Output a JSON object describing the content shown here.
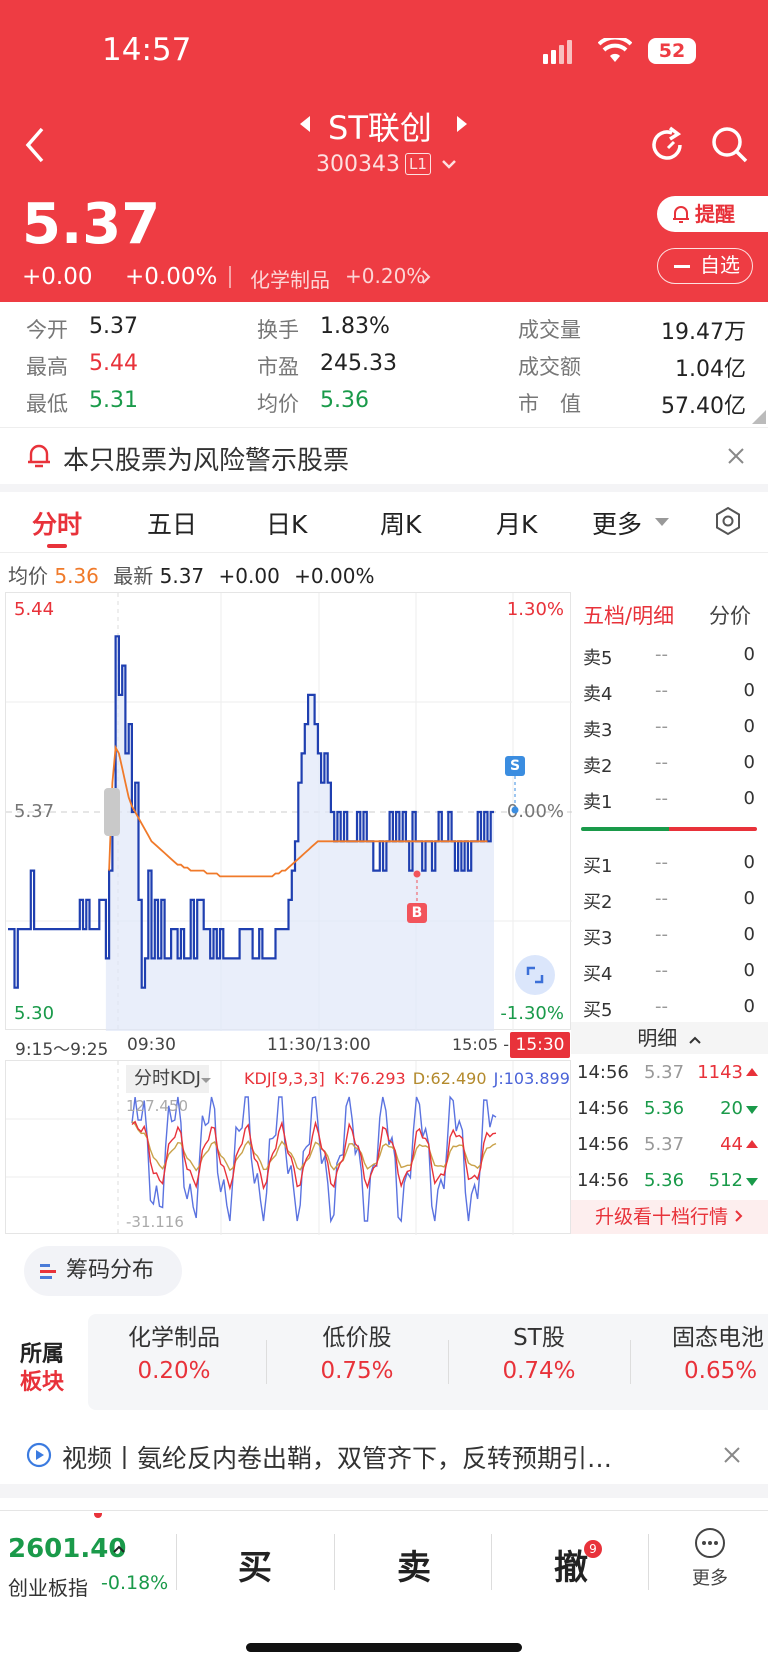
{
  "status_bar": {
    "time": "14:57",
    "battery": "52"
  },
  "header": {
    "title": "ST联创",
    "code": "300343",
    "level_badge": "L1",
    "price": "5.37",
    "change": "+0.00",
    "change_pct": "+0.00%",
    "sector_name": "化学制品",
    "sector_change": "+0.20%",
    "remind_label": "提醒",
    "watchlist_label": "自选"
  },
  "stats": [
    {
      "label": "今开",
      "value": "5.37",
      "tone": "neutral"
    },
    {
      "label": "换手",
      "value": "1.83%",
      "tone": "neutral"
    },
    {
      "label": "成交量",
      "value": "19.47万",
      "tone": "neutral"
    },
    {
      "label": "最高",
      "value": "5.44",
      "tone": "red"
    },
    {
      "label": "市盈",
      "value": "245.33",
      "tone": "neutral"
    },
    {
      "label": "成交额",
      "value": "1.04亿",
      "tone": "neutral"
    },
    {
      "label": "最低",
      "value": "5.31",
      "tone": "green"
    },
    {
      "label": "均价",
      "value": "5.36",
      "tone": "green"
    },
    {
      "label": "市　值",
      "value": "57.40亿",
      "tone": "neutral"
    }
  ],
  "warning": {
    "text": "本只股票为风险警示股票"
  },
  "tabs": {
    "active": "分时",
    "items": [
      "分时",
      "五日",
      "日K",
      "周K",
      "月K",
      "更多"
    ]
  },
  "info_line": {
    "avg_label": "均价",
    "avg_value": "5.36",
    "latest_label": "最新",
    "latest_value": "5.37",
    "change": "+0.00",
    "change_pct": "+0.00%"
  },
  "chart_data": {
    "type": "line",
    "y_labels": {
      "top": "5.44",
      "mid": "5.37",
      "bottom": "5.30",
      "top_pct": "1.30%",
      "mid_pct": "0.00%",
      "bottom_pct": "-1.30%"
    },
    "ylim": [
      5.3,
      5.44
    ],
    "x_labels": [
      "9:15～9:25",
      "09:30",
      "11:30/13:00",
      "15:05 -",
      "15:30"
    ],
    "series": [
      {
        "color": "#1f3fb0",
        "values": [
          5.33,
          5.33,
          5.31,
          5.33,
          5.33,
          5.33,
          5.33,
          5.35,
          5.33,
          5.33,
          5.33,
          5.33,
          5.33,
          5.33,
          5.33,
          5.33,
          5.33,
          5.33,
          5.33,
          5.33,
          5.33,
          5.33,
          5.34,
          5.33,
          5.34,
          5.33,
          5.33,
          5.33,
          5.34,
          5.34,
          5.32,
          5.35,
          5.37,
          5.43,
          5.41,
          5.42,
          5.39,
          5.4,
          5.37,
          5.38,
          5.34,
          5.31,
          5.32,
          5.35,
          5.32,
          5.34,
          5.32,
          5.34,
          5.32,
          5.32,
          5.33,
          5.33,
          5.32,
          5.33,
          5.32,
          5.32,
          5.34,
          5.32,
          5.34,
          5.34,
          5.33,
          5.33,
          5.32,
          5.33,
          5.32,
          5.33,
          5.32,
          5.32,
          5.32,
          5.32,
          5.32,
          5.33,
          5.33,
          5.33,
          5.33,
          5.32,
          5.32,
          5.33,
          5.32,
          5.32,
          5.32,
          5.32,
          5.33,
          5.33,
          5.33,
          5.33,
          5.34,
          5.35,
          5.36,
          5.38,
          5.39,
          5.4,
          5.41,
          5.41,
          5.4,
          5.39,
          5.38,
          5.39,
          5.38,
          5.37,
          5.36,
          5.37,
          5.36,
          5.37,
          5.36,
          5.36,
          5.36,
          5.37,
          5.36,
          5.37,
          5.36,
          5.36,
          5.35,
          5.35,
          5.36,
          5.35,
          5.36,
          5.37,
          5.36,
          5.37,
          5.36,
          5.37,
          5.36,
          5.35,
          5.37,
          5.36,
          5.36,
          5.35,
          5.36,
          5.36,
          5.35,
          5.36,
          5.37,
          5.36,
          5.36,
          5.37,
          5.36,
          5.35,
          5.36,
          5.35,
          5.36,
          5.35,
          5.36,
          5.36,
          5.37,
          5.36,
          5.37,
          5.36,
          5.37,
          5.37
        ]
      },
      {
        "color": "#f07a2a",
        "values": [
          null,
          null,
          null,
          null,
          null,
          null,
          null,
          null,
          null,
          null,
          null,
          null,
          null,
          null,
          null,
          null,
          null,
          null,
          null,
          null,
          null,
          null,
          null,
          null,
          null,
          null,
          null,
          null,
          null,
          null,
          null,
          5.35,
          5.38,
          5.392,
          5.39,
          5.385,
          5.38,
          5.375,
          5.372,
          5.37,
          5.368,
          5.366,
          5.364,
          5.362,
          5.36,
          5.359,
          5.358,
          5.357,
          5.356,
          5.355,
          5.354,
          5.353,
          5.352,
          5.352,
          5.351,
          5.351,
          5.35,
          5.35,
          5.35,
          5.35,
          5.35,
          5.349,
          5.349,
          5.349,
          5.349,
          5.348,
          5.348,
          5.348,
          5.348,
          5.348,
          5.348,
          5.348,
          5.348,
          5.348,
          5.348,
          5.348,
          5.348,
          5.348,
          5.348,
          5.348,
          5.348,
          5.348,
          5.349,
          5.349,
          5.35,
          5.35,
          5.351,
          5.352,
          5.353,
          5.354,
          5.355,
          5.356,
          5.357,
          5.358,
          5.359,
          5.36,
          5.36,
          5.36,
          5.36,
          5.36,
          5.36,
          5.36,
          5.36,
          5.36,
          5.36,
          5.36,
          5.36,
          5.36,
          5.36,
          5.36,
          5.36,
          5.36,
          5.36,
          5.36,
          5.36,
          5.36,
          5.36,
          5.36,
          5.36,
          5.36,
          5.36,
          5.36,
          5.36,
          5.36,
          5.36,
          5.36,
          5.36,
          5.36,
          5.36,
          5.36,
          5.36,
          5.36,
          5.36,
          5.36,
          5.36,
          5.36,
          5.36,
          5.36,
          5.36,
          5.36,
          5.36,
          5.36,
          5.36,
          5.36,
          5.36,
          5.36,
          5.36,
          5.36
        ]
      }
    ],
    "markers": [
      {
        "label": "S",
        "color": "#3b8de0"
      },
      {
        "label": "B",
        "color": "#e8323a"
      }
    ]
  },
  "kdj": {
    "title": "分时KDJ",
    "params": "KDJ[9,3,3]",
    "k": "K:76.293",
    "d": "D:62.490",
    "j": "J:103.899",
    "top": "127.450",
    "bottom": "-31.116"
  },
  "orderbook": {
    "tab_active": "五档/明细",
    "tab_other": "分价",
    "asks": [
      {
        "label": "卖5",
        "price": "--",
        "vol": "0"
      },
      {
        "label": "卖4",
        "price": "--",
        "vol": "0"
      },
      {
        "label": "卖3",
        "price": "--",
        "vol": "0"
      },
      {
        "label": "卖2",
        "price": "--",
        "vol": "0"
      },
      {
        "label": "卖1",
        "price": "--",
        "vol": "0"
      }
    ],
    "bids": [
      {
        "label": "买1",
        "price": "--",
        "vol": "0"
      },
      {
        "label": "买2",
        "price": "--",
        "vol": "0"
      },
      {
        "label": "买3",
        "price": "--",
        "vol": "0"
      },
      {
        "label": "买4",
        "price": "--",
        "vol": "0"
      },
      {
        "label": "买5",
        "price": "--",
        "vol": "0"
      }
    ],
    "detail_label": "明细",
    "ticks": [
      {
        "time": "14:56",
        "price": "5.37",
        "vol": "1143",
        "dir": "up"
      },
      {
        "time": "14:56",
        "price": "5.36",
        "vol": "20",
        "dir": "down"
      },
      {
        "time": "14:56",
        "price": "5.37",
        "vol": "44",
        "dir": "up"
      },
      {
        "time": "14:56",
        "price": "5.36",
        "vol": "512",
        "dir": "down"
      }
    ],
    "upgrade_label": "升级看十档行情"
  },
  "chip": {
    "label": "筹码分布"
  },
  "sectors": {
    "title_line1": "所属",
    "title_line2": "板块",
    "items": [
      {
        "name": "化学制品",
        "change": "0.20%"
      },
      {
        "name": "低价股",
        "change": "0.75%"
      },
      {
        "name": "ST股",
        "change": "0.74%"
      },
      {
        "name": "固态电池",
        "change": "0.65%"
      }
    ]
  },
  "news": {
    "text": "视频丨氨纶反内卷出鞘，双管齐下，反转预期引…"
  },
  "bottom": {
    "index_value": "2601.40",
    "index_name": "创业板指",
    "index_change": "-0.18%",
    "buy": "买",
    "sell": "卖",
    "cancel": "撤",
    "cancel_badge": "9",
    "more": "更多"
  }
}
